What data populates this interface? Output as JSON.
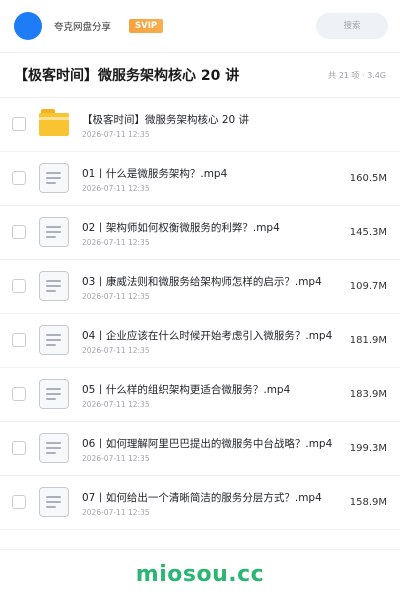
{
  "header": {
    "user_name": "夸克网盘分享",
    "badge": "SVIP",
    "search_placeholder": "搜索"
  },
  "folder": {
    "title": "【极客时间】微服务架构核心 20 讲",
    "meta": "共 21 项 · 3.4G"
  },
  "files": [
    {
      "type": "folder",
      "name": "【极客时间】微服务架构核心 20 讲",
      "date": "2026-07-11 12:35",
      "size": ""
    },
    {
      "type": "file",
      "name": "01丨什么是微服务架构？.mp4",
      "date": "2026-07-11 12:35",
      "size": "160.5M"
    },
    {
      "type": "file",
      "name": "02丨架构师如何权衡微服务的利弊？.mp4",
      "date": "2026-07-11 12:35",
      "size": "145.3M"
    },
    {
      "type": "file",
      "name": "03丨康威法则和微服务给架构师怎样的启示？.mp4",
      "date": "2026-07-11 12:35",
      "size": "109.7M"
    },
    {
      "type": "file",
      "name": "04丨企业应该在什么时候开始考虑引入微服务？.mp4",
      "date": "2026-07-11 12:35",
      "size": "181.9M"
    },
    {
      "type": "file",
      "name": "05丨什么样的组织架构更适合微服务？.mp4",
      "date": "2026-07-11 12:35",
      "size": "183.9M"
    },
    {
      "type": "file",
      "name": "06丨如何理解阿里巴巴提出的微服务中台战略？.mp4",
      "date": "2026-07-11 12:35",
      "size": "199.3M"
    },
    {
      "type": "file",
      "name": "07丨如何给出一个清晰简洁的服务分层方式？.mp4",
      "date": "2026-07-11 12:35",
      "size": "158.9M"
    }
  ],
  "watermark": "miosou.cc",
  "colors": {
    "avatar": "#1e7cf6",
    "badge": "#f6a43f",
    "folder": "#f9c431",
    "watermark": "#2bb673"
  }
}
